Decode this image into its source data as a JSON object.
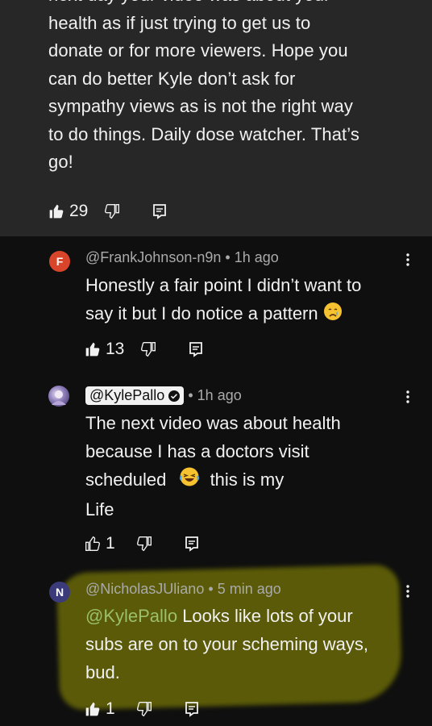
{
  "top_comment": {
    "text_lines": [
      "next day your video was about your",
      "health as if just trying to get us to",
      "donate or for more viewers. Hope you",
      "can do better Kyle don’t ask for",
      "sympathy views as is not the right way",
      "to do things. Daily dose watcher. That’s",
      "go!"
    ],
    "likes": "29"
  },
  "replies": [
    {
      "avatar_letter": "F",
      "avatar_color": "#d9452b",
      "author": "@FrankJohnson-n9n",
      "separator": "•",
      "time": "1h ago",
      "lines": [
        "Honestly a fair point I didn’t want to",
        "say it but I do notice a pattern"
      ],
      "likes": "13"
    },
    {
      "author": "@KylePallo",
      "separator": "•",
      "time": "1h ago",
      "lines": [
        "The next video was about health",
        "because I has a doctors visit",
        "scheduled",
        "this is my",
        "Life"
      ],
      "likes": "1"
    },
    {
      "avatar_letter": "N",
      "avatar_color": "#3b3a7a",
      "author": "@NicholasJUliano",
      "separator": "•",
      "time": "5 min ago",
      "mention": "@KylePallo",
      "lines": [
        "Looks like lots of your",
        "subs are on to your scheming ways,",
        "bud."
      ],
      "likes": "1"
    }
  ],
  "colors": {
    "background": "#0f0f0f",
    "top_comment_bg": "#272727",
    "meta_text": "#aaaaaa",
    "mention": "#9bc06b",
    "highlight": "#5f5f08"
  },
  "icons": [
    "thumbs-up-icon",
    "thumbs-down-icon",
    "reply-icon",
    "more-vert-icon",
    "verified-icon",
    "crying-emoji-icon",
    "laughing-emoji-icon"
  ]
}
